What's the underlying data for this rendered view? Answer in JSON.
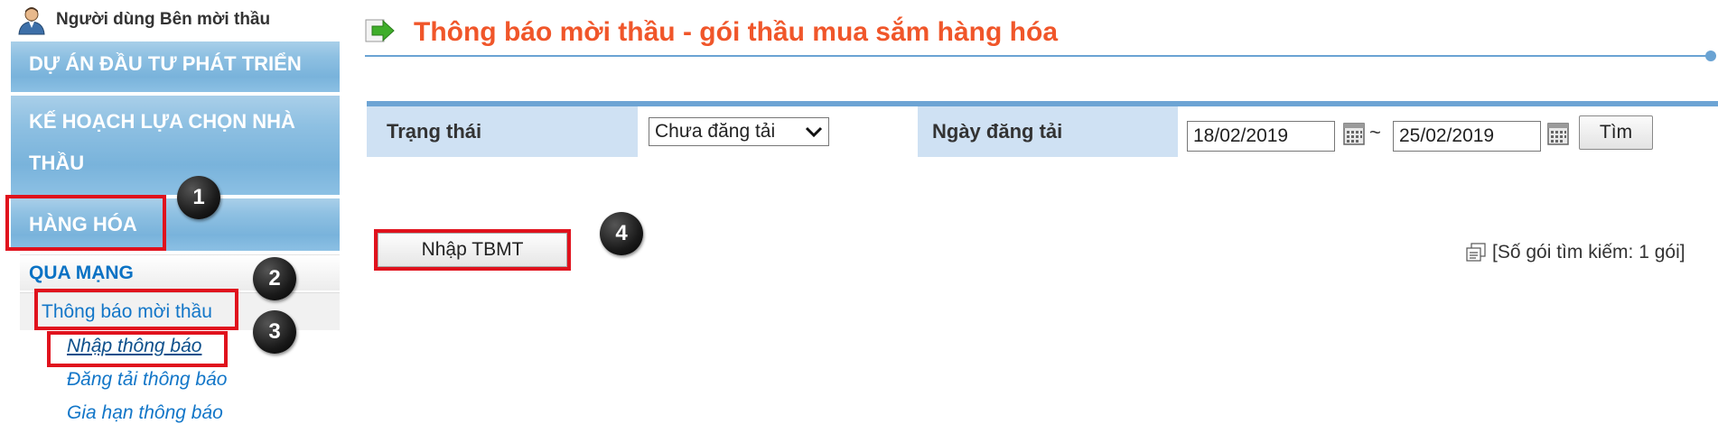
{
  "sidebar": {
    "user_label": "Người dùng Bên mời thầu",
    "menu": [
      {
        "label": "DỰ ÁN ĐẦU TƯ PHÁT TRIỂN"
      },
      {
        "label_line1": "KẾ HOẠCH LỰA CHỌN NHÀ",
        "label_line2": "THẦU"
      },
      {
        "label": "HÀNG HÓA"
      }
    ],
    "section_header": "QUA MẠNG",
    "sub_item": "Thông báo mời thầu",
    "leaves": [
      "Nhập thông báo",
      "Đăng tải thông báo",
      "Gia hạn thông báo"
    ]
  },
  "header": {
    "title": "Thông báo mời thầu - gói thầu mua sắm hàng hóa"
  },
  "filter": {
    "status_label": "Trạng thái",
    "status_value": "Chưa đăng tải",
    "date_label": "Ngày đăng tải",
    "date_from": "18/02/2019",
    "date_separator": "~",
    "date_to": "25/02/2019",
    "search_button": "Tìm"
  },
  "actions": {
    "create_button": "Nhập TBMT",
    "result_text": "[Số gói tìm kiếm: 1 gói]"
  },
  "annotations": {
    "badges": [
      "1",
      "2",
      "3",
      "4"
    ],
    "highlight_color": "#e0121d"
  },
  "colors": {
    "title": "#f0562a",
    "menu_blue": "#8ec0e2",
    "link_blue": "#1276c8",
    "filter_bar": "#cfe1f3"
  }
}
